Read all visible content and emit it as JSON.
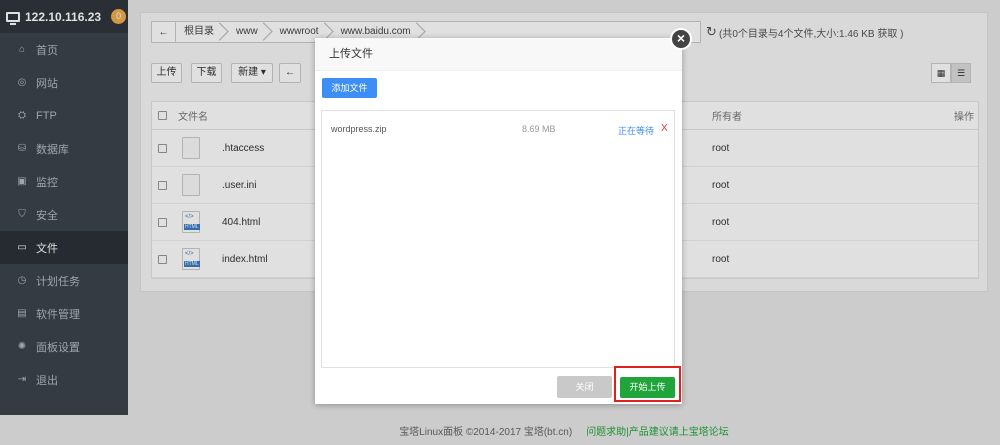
{
  "server": {
    "ip": "122.10.116.23",
    "badge": "0"
  },
  "sidebar": {
    "items": [
      {
        "label": "首页",
        "icon": "home-icon",
        "glyph": "⌂"
      },
      {
        "label": "网站",
        "icon": "globe-icon",
        "glyph": "◎"
      },
      {
        "label": "FTP",
        "icon": "ftp-icon",
        "glyph": "⛭"
      },
      {
        "label": "数据库",
        "icon": "database-icon",
        "glyph": "⛁"
      },
      {
        "label": "监控",
        "icon": "monitor-icon",
        "glyph": "▣"
      },
      {
        "label": "安全",
        "icon": "shield-icon",
        "glyph": "⛉"
      },
      {
        "label": "文件",
        "icon": "folder-icon",
        "glyph": "▭"
      },
      {
        "label": "计划任务",
        "icon": "clock-icon",
        "glyph": "◷"
      },
      {
        "label": "软件管理",
        "icon": "apps-icon",
        "glyph": "▤"
      },
      {
        "label": "面板设置",
        "icon": "gear-icon",
        "glyph": "✺"
      },
      {
        "label": "退出",
        "icon": "logout-icon",
        "glyph": "⇥"
      }
    ],
    "active_index": 6
  },
  "path": {
    "back_glyph": "←",
    "crumbs": [
      "根目录",
      "www",
      "wwwroot",
      "www.baidu.com"
    ],
    "dir_info": "(共0个目录与4个文件,大小:1.46 KB  获取 )"
  },
  "toolbar": {
    "upload": "上传",
    "download": "下载",
    "new": "新建 ▾",
    "back_glyph": "←"
  },
  "table": {
    "headers": {
      "name": "文件名",
      "owner": "所有者",
      "ops": "操作"
    },
    "rows": [
      {
        "name": ".htaccess",
        "owner": "root"
      },
      {
        "name": ".user.ini",
        "owner": "root"
      },
      {
        "name": "404.html",
        "owner": "root"
      },
      {
        "name": "index.html",
        "owner": "root"
      }
    ]
  },
  "footer": {
    "copyright": "宝塔Linux面板 ©2014-2017 宝塔(bt.cn)",
    "link": "问题求助|产品建议请上宝塔论坛"
  },
  "dialog": {
    "title": "上传文件",
    "add_file": "添加文件",
    "files": [
      {
        "name": "wordpress.zip",
        "size": "8.69 MB",
        "status": "正在等待",
        "remove": "X"
      }
    ],
    "close_label": "关闭",
    "start_label": "开始上传",
    "close_x": "×"
  }
}
